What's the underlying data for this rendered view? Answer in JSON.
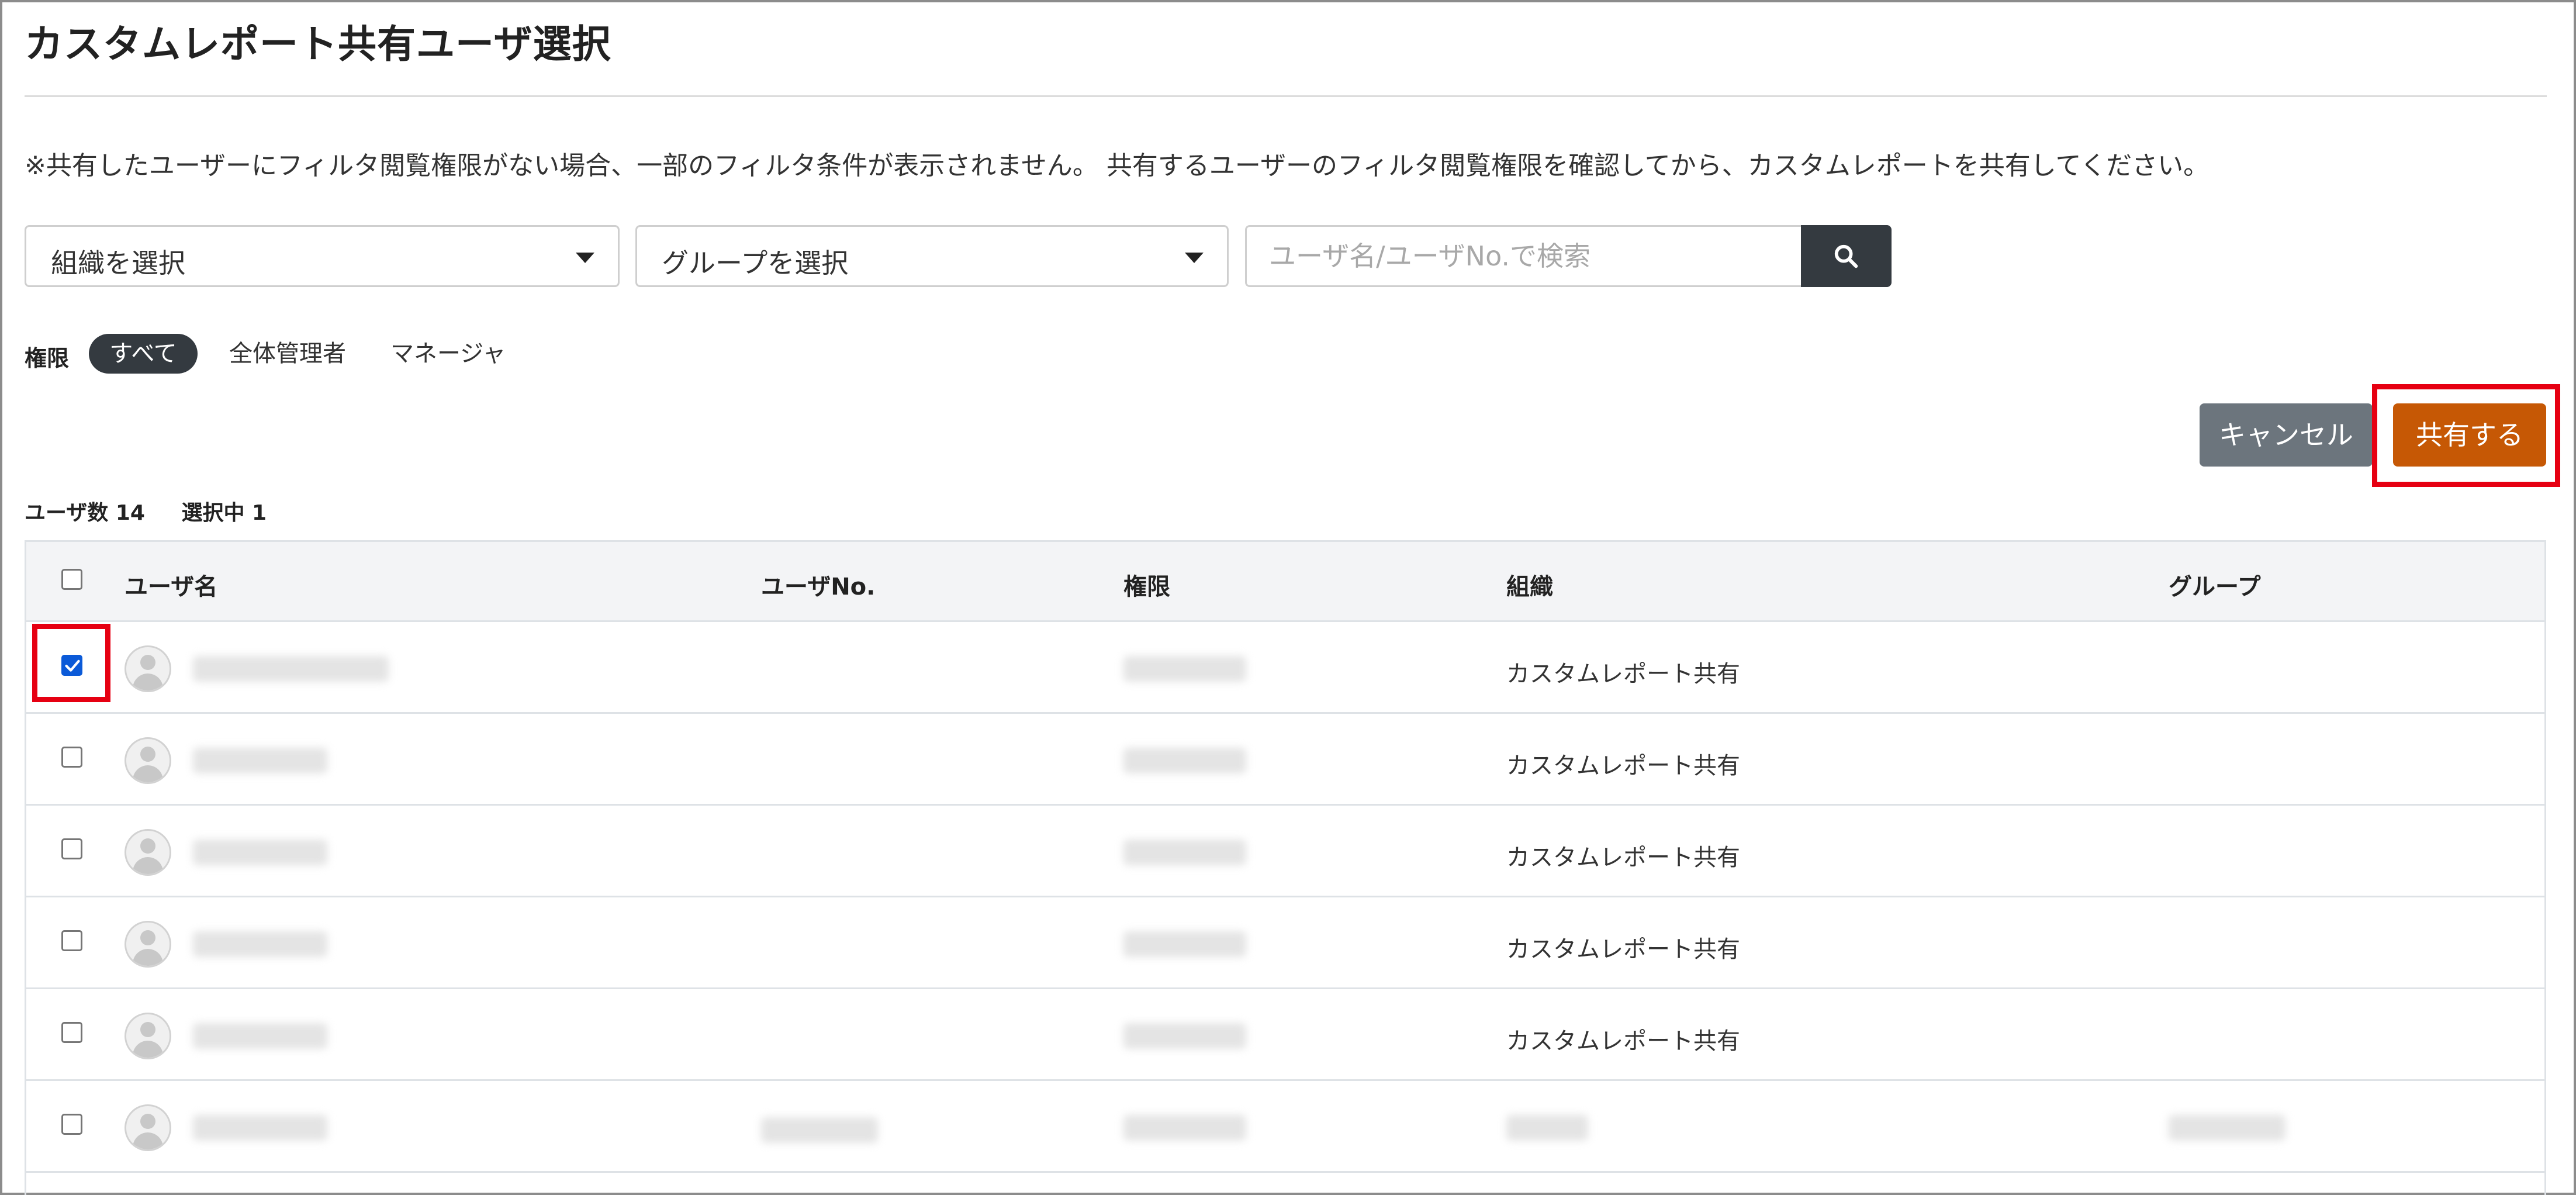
{
  "page": {
    "title": "カスタムレポート共有ユーザ選択",
    "notice": "※共有したユーザーにフィルタ閲覧権限がない場合、一部のフィルタ条件が表示されません。 共有するユーザーのフィルタ閲覧権限を確認してから、カスタムレポートを共有してください。"
  },
  "filters": {
    "organization_select": "組織を選択",
    "group_select": "グループを選択",
    "search_placeholder": "ユーザ名/ユーザNo.で検索",
    "permission_label": "権限",
    "permission_options": [
      "すべて",
      "全体管理者",
      "マネージャ"
    ],
    "permission_selected": "すべて"
  },
  "actions": {
    "cancel_label": "キャンセル",
    "share_label": "共有する"
  },
  "summary": {
    "user_count": "ユーザ数 14",
    "selected_count": "選択中 1"
  },
  "table": {
    "headers": [
      "ユーザ名",
      "ユーザNo.",
      "権限",
      "組織",
      "グループ"
    ],
    "rows": [
      {
        "checked": true,
        "organization": "カスタムレポート共有"
      },
      {
        "checked": false,
        "organization": "カスタムレポート共有"
      },
      {
        "checked": false,
        "organization": "カスタムレポート共有"
      },
      {
        "checked": false,
        "organization": "カスタムレポート共有"
      },
      {
        "checked": false,
        "organization": "カスタムレポート共有"
      },
      {
        "checked": false,
        "organization": ""
      }
    ]
  },
  "colors": {
    "primary_dark": "#343a40",
    "cancel_gray": "#6c757d",
    "share_orange": "#c65805",
    "highlight_red": "#e60012",
    "checkbox_blue": "#0b5ad8"
  },
  "icons": {
    "search_button": "search-icon",
    "select_caret": "caret-down-icon",
    "avatar": "user-avatar-icon",
    "checkbox_checked": "checkmark-icon"
  }
}
